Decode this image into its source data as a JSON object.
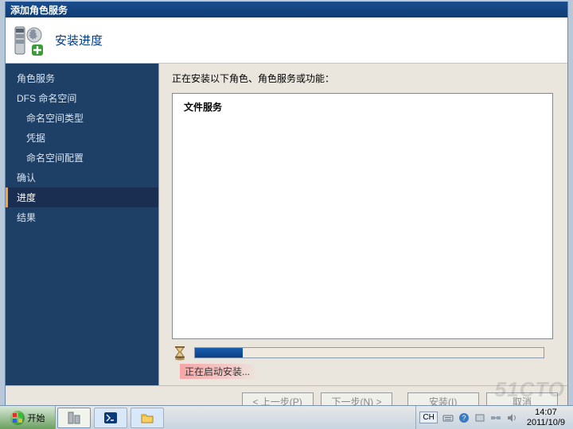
{
  "window": {
    "title": "添加角色服务"
  },
  "header": {
    "title": "安装进度"
  },
  "sidebar": {
    "items": [
      {
        "label": "角色服务",
        "level": 1,
        "selected": false
      },
      {
        "label": "DFS 命名空间",
        "level": 1,
        "selected": false
      },
      {
        "label": "命名空间类型",
        "level": 2,
        "selected": false
      },
      {
        "label": "凭据",
        "level": 2,
        "selected": false
      },
      {
        "label": "命名空间配置",
        "level": 2,
        "selected": false
      },
      {
        "label": "确认",
        "level": 1,
        "selected": false
      },
      {
        "label": "进度",
        "level": 1,
        "selected": true
      },
      {
        "label": "结果",
        "level": 1,
        "selected": false
      }
    ]
  },
  "main": {
    "intro": "正在安装以下角色、角色服务或功能：",
    "role_entry": "文件服务",
    "progress_pct": 13,
    "status": "正在启动安装..."
  },
  "buttons": {
    "prev": "< 上一步(P)",
    "next": "下一步(N) >",
    "install": "安装(I)",
    "cancel": "取消"
  },
  "taskbar": {
    "start_label": "开始",
    "lang": "CH",
    "time": "14:07",
    "date": "2011/10/9"
  },
  "watermark": "51CTO"
}
